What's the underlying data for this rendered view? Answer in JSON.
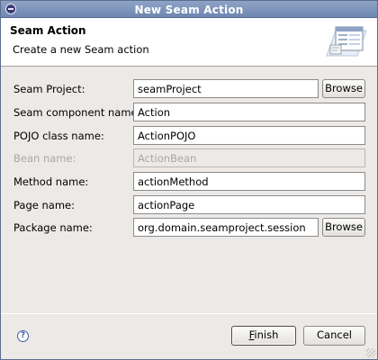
{
  "window": {
    "title": "New Seam Action"
  },
  "header": {
    "title": "Seam Action",
    "subtitle": "Create a new Seam action"
  },
  "form": {
    "browse_label": "Browse",
    "fields": [
      {
        "label": "Seam Project:",
        "value": "seamProject",
        "enabled": true,
        "has_browse": true
      },
      {
        "label": "Seam component name:",
        "value": "Action",
        "enabled": true
      },
      {
        "label": "POJO class name:",
        "value": "ActionPOJO",
        "enabled": true
      },
      {
        "label": "Bean name:",
        "value": "ActionBean",
        "enabled": false
      },
      {
        "label": "Method name:",
        "value": "actionMethod",
        "enabled": true
      },
      {
        "label": "Page name:",
        "value": "actionPage",
        "enabled": true
      },
      {
        "label": "Package name:",
        "value": "org.domain.seamproject.session",
        "enabled": true,
        "has_browse": true
      }
    ]
  },
  "footer": {
    "help_icon": "question-mark",
    "help_glyph": "?",
    "finish_mnemonic": "F",
    "finish_rest": "inish",
    "cancel_label": "Cancel"
  }
}
